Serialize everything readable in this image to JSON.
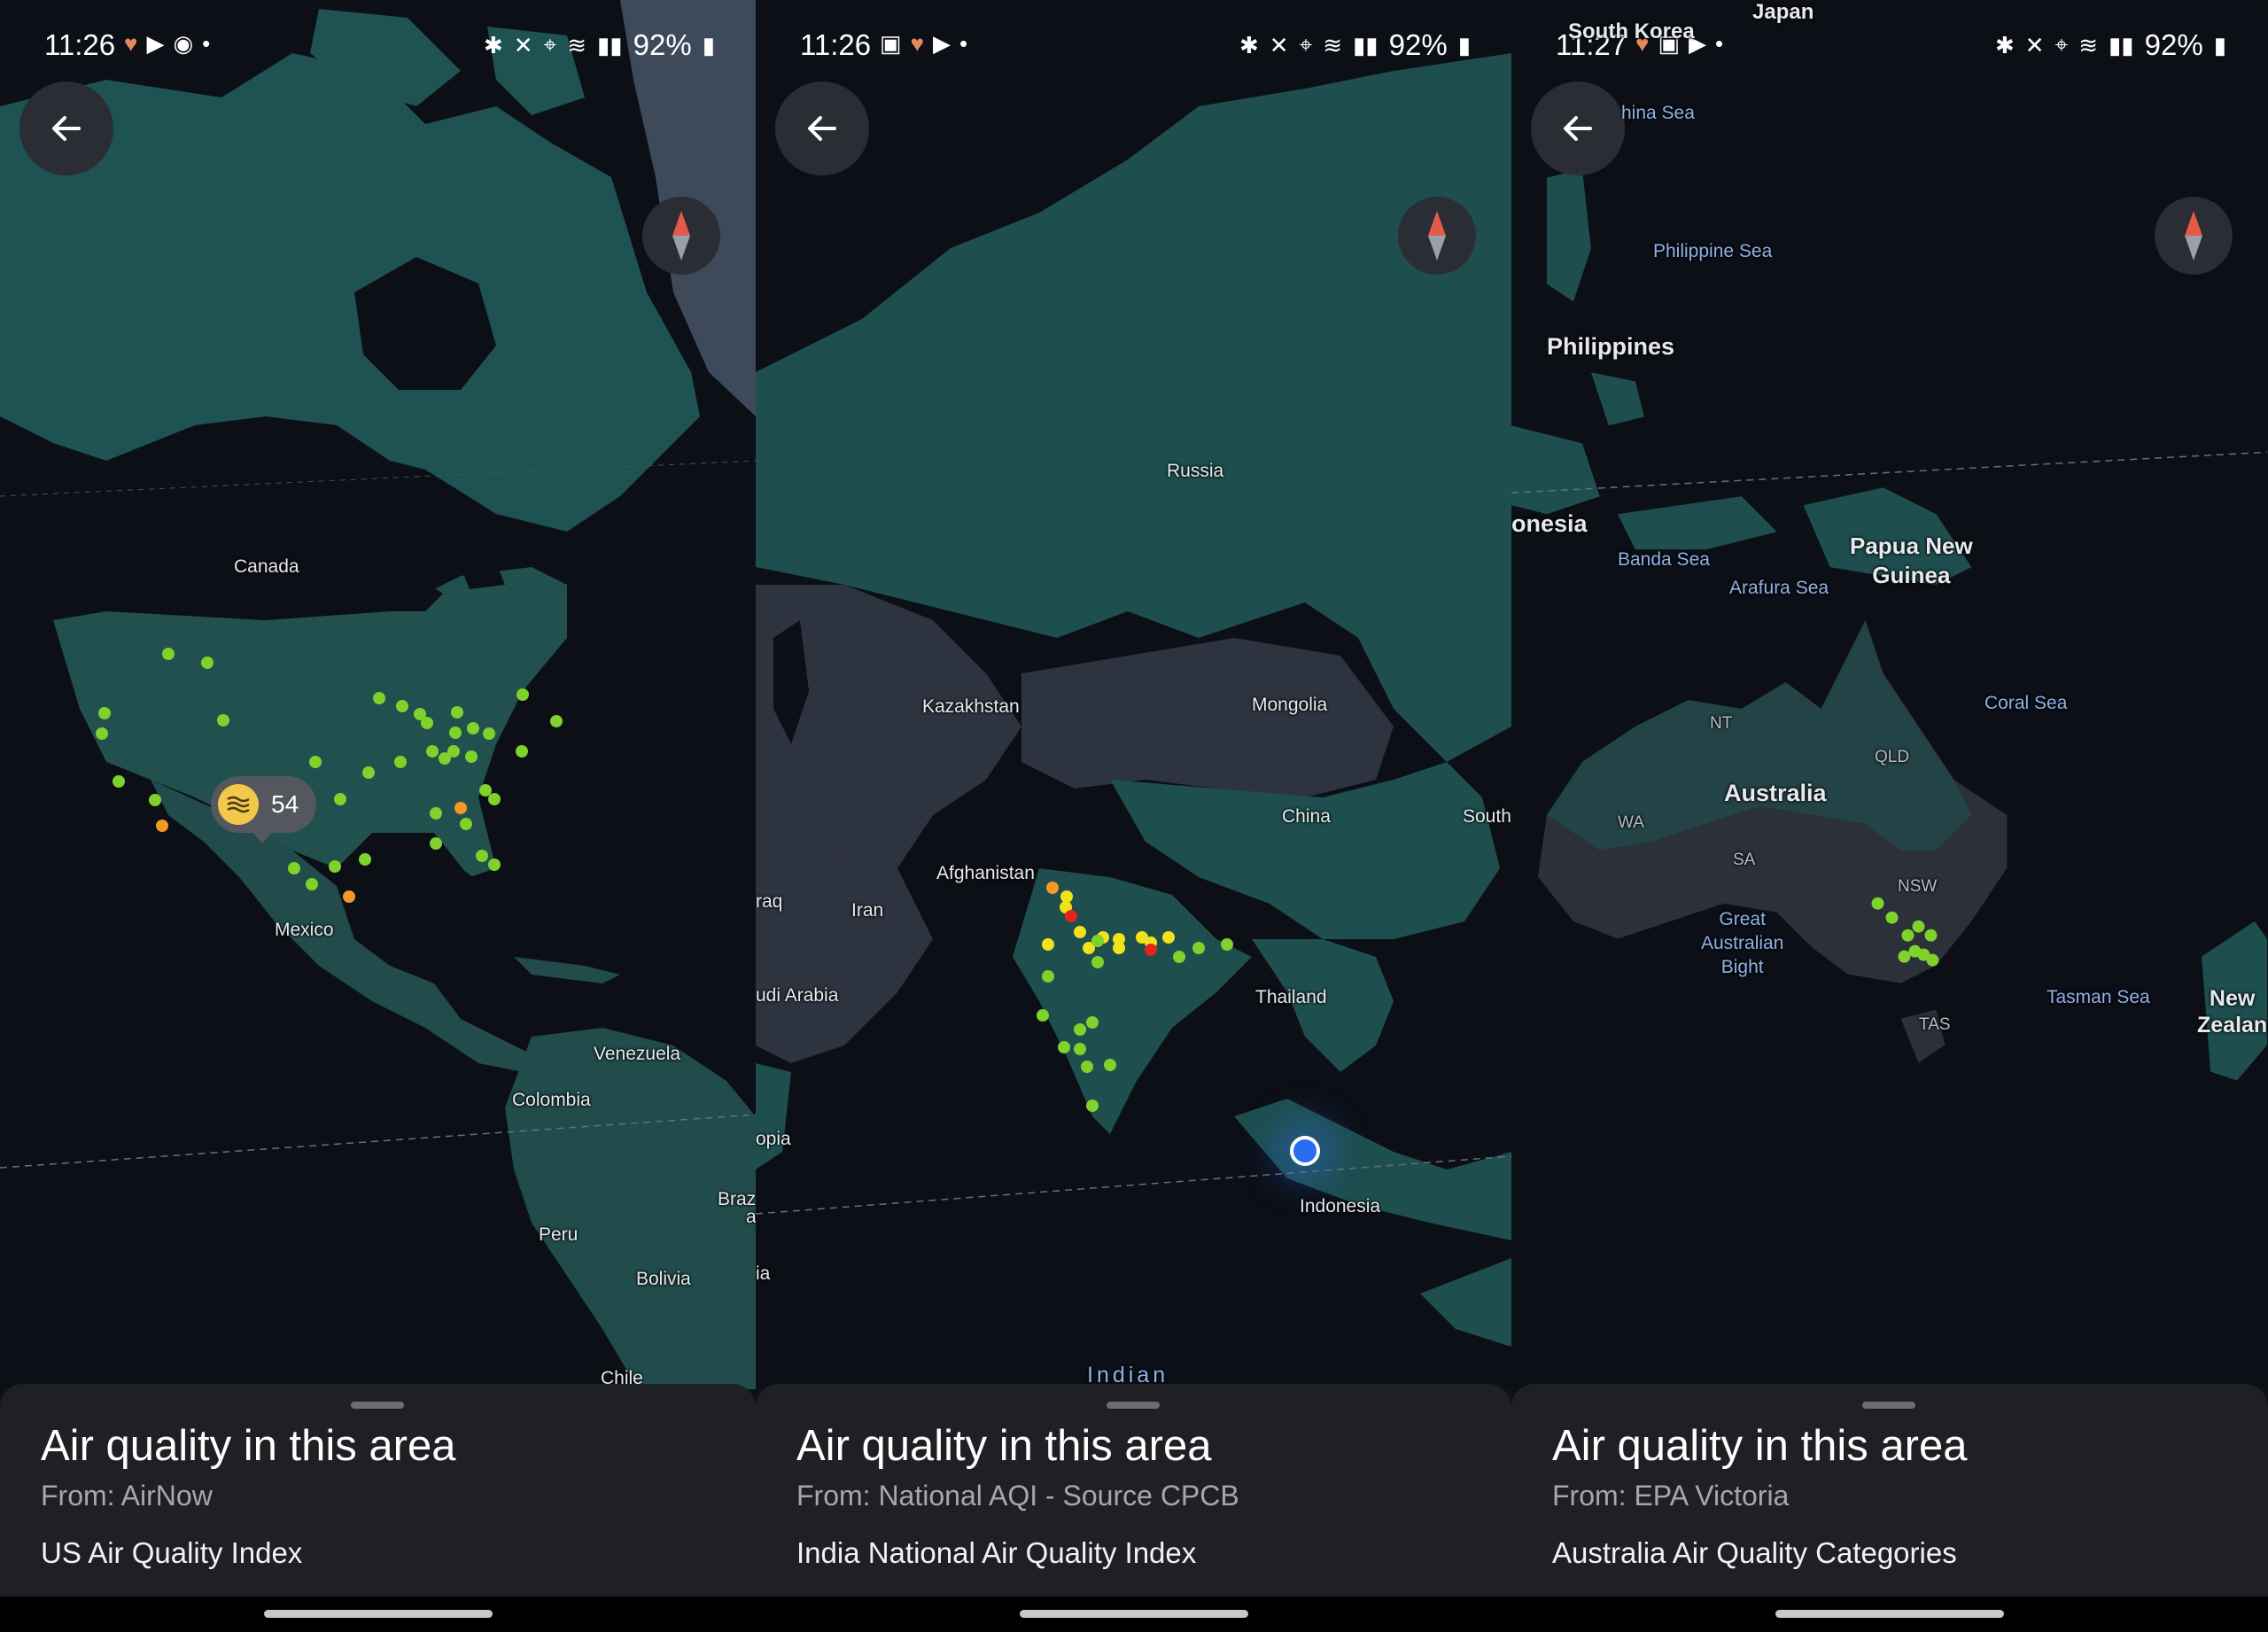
{
  "panels": [
    {
      "status": {
        "time": "11:26",
        "battery": "92%"
      },
      "labels": {
        "canada": "Canada",
        "mexico": "Mexico",
        "venezuela": "Venezuela",
        "colombia": "Colombia",
        "peru": "Peru",
        "bolivia": "Bolivia",
        "braz": "Braz",
        "chile": "Chile",
        "a": "a"
      },
      "marker": {
        "value": "54",
        "color": "#f2c84b"
      },
      "sheet": {
        "title": "Air quality in this area",
        "source": "From: AirNow",
        "index": "US Air Quality Index"
      }
    },
    {
      "status": {
        "time": "11:26",
        "battery": "92%"
      },
      "labels": {
        "russia": "Russia",
        "kazakhstan": "Kazakhstan",
        "mongolia": "Mongolia",
        "china": "China",
        "south": "South",
        "afghanistan": "Afghanistan",
        "iraq": "raq",
        "iran": "Iran",
        "saudi": "udi Arabia",
        "thailand": "Thailand",
        "indonesia": "Indonesia",
        "opia": "opia",
        "ia": "ia",
        "indian": "Indian"
      },
      "sheet": {
        "title": "Air quality in this area",
        "source": "From: National AQI - Source CPCB",
        "index": "India National Air Quality Index"
      }
    },
    {
      "status": {
        "time": "11:27",
        "battery": "92%"
      },
      "labels": {
        "south_korea": "South Korea",
        "japan": "Japan",
        "china_sea": "hina Sea",
        "philippine_sea": "Philippine Sea",
        "philippines": "Philippines",
        "indonesia": "onesia",
        "banda_sea": "Banda Sea",
        "arafura_sea": "Arafura Sea",
        "png": "Papua New\nGuinea",
        "coral_sea": "Coral Sea",
        "nt": "NT",
        "qld": "QLD",
        "australia": "Australia",
        "wa": "WA",
        "sa": "SA",
        "nsw": "NSW",
        "bight": "Great\nAustralian\nBight",
        "tasman_sea": "Tasman Sea",
        "tas": "TAS",
        "new_zealand": "New\nZealan"
      },
      "sheet": {
        "title": "Air quality in this area",
        "source": "From: EPA Victoria",
        "index": "Australia Air Quality Categories"
      }
    }
  ],
  "colors": {
    "good": "#7fd12b",
    "moderate": "#f0e31a",
    "usg": "#f39a25",
    "unhealthy": "#e3241c",
    "land": "#1c4b4b",
    "water": "#0c0f16",
    "location": "#2a6df0"
  }
}
